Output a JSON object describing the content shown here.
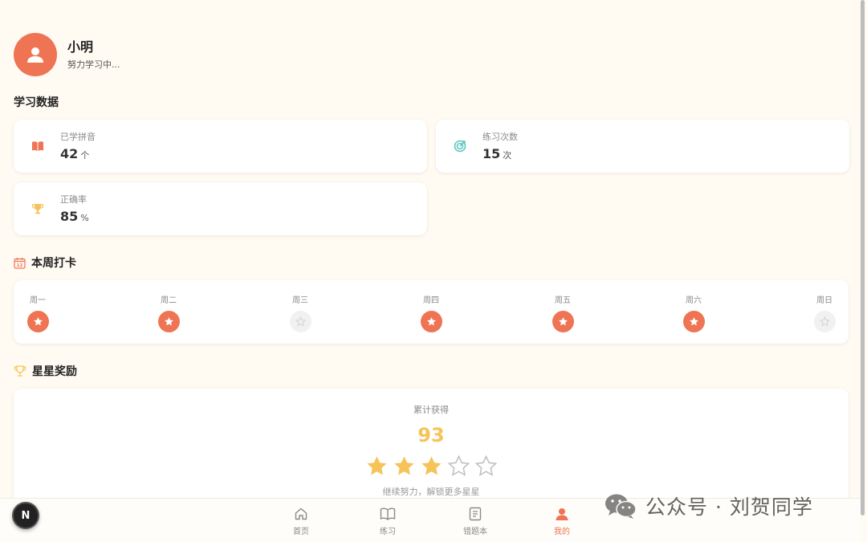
{
  "profile": {
    "name": "小明",
    "status": "努力学习中..."
  },
  "stats_section": {
    "title": "学习数据"
  },
  "stats": [
    {
      "label": "已学拼音",
      "value": "42",
      "unit": "个",
      "icon": "book-icon",
      "color": "#ef7454"
    },
    {
      "label": "练习次数",
      "value": "15",
      "unit": "次",
      "icon": "target-icon",
      "color": "#5ec7c0"
    },
    {
      "label": "正确率",
      "value": "85",
      "unit": "%",
      "icon": "trophy-icon",
      "color": "#f6c358"
    }
  ],
  "week": {
    "title": "本周打卡",
    "icon": "calendar-icon",
    "days": [
      {
        "label": "周一",
        "done": true
      },
      {
        "label": "周二",
        "done": true
      },
      {
        "label": "周三",
        "done": false
      },
      {
        "label": "周四",
        "done": true
      },
      {
        "label": "周五",
        "done": true
      },
      {
        "label": "周六",
        "done": true
      },
      {
        "label": "周日",
        "done": false
      }
    ]
  },
  "rewards": {
    "title": "星星奖励",
    "icon": "trophy-icon",
    "label": "累计获得",
    "count": "93",
    "stars_filled": 3,
    "stars_total": 5,
    "hint": "继续努力，解锁更多星星"
  },
  "nav": {
    "items": [
      {
        "label": "首页",
        "icon": "home-icon",
        "active": false
      },
      {
        "label": "练习",
        "icon": "open-book-icon",
        "active": false
      },
      {
        "label": "错题本",
        "icon": "notebook-icon",
        "active": false
      },
      {
        "label": "我的",
        "icon": "user-icon",
        "active": true
      }
    ]
  },
  "dev_badge": {
    "label": "N"
  },
  "watermark": {
    "text": "公众号 · 刘贺同学"
  },
  "colors": {
    "accent": "#ef7454",
    "gold": "#f6c358",
    "teal": "#5ec7c0",
    "background": "#fffaf2"
  }
}
